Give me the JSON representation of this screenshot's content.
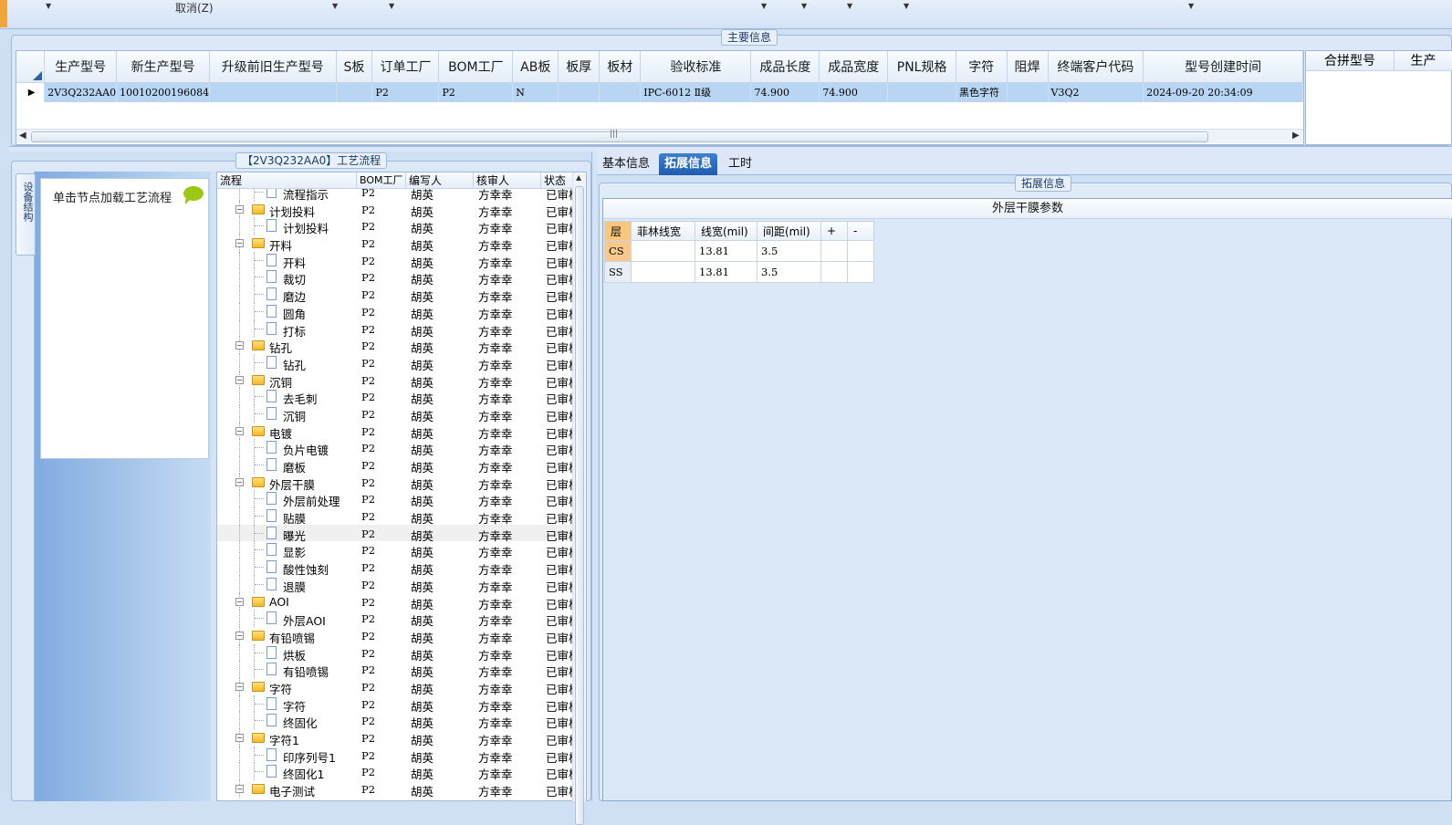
{
  "toolbar": {
    "cancel_label": "取消(Z)"
  },
  "main_info": {
    "caption": "主要信息",
    "columns": [
      "生产型号",
      "新生产型号",
      "升级前旧生产型号",
      "S板",
      "订单工厂",
      "BOM工厂",
      "AB板",
      "板厚",
      "板材",
      "验收标准",
      "成品长度",
      "成品宽度",
      "PNL规格",
      "字符",
      "阻焊",
      "终端客户代码",
      "型号创建时间"
    ],
    "row": [
      "2V3Q232AA0",
      "10010200196084",
      "",
      "",
      "P2",
      "P2",
      "N",
      "",
      "",
      "IPC-6012 Ⅱ级",
      "74.900",
      "74.900",
      "",
      "黑色字符",
      "",
      "V3Q2",
      "2024-09-20 20:34:09"
    ],
    "merge_columns": [
      "合拼型号",
      "生产"
    ]
  },
  "process": {
    "caption": "【2V3Q232AA0】工艺流程",
    "side_tab": "设备结构",
    "hint": "单击节点加载工艺流程",
    "columns": [
      "流程",
      "BOM工厂",
      "编写人",
      "核审人",
      "状态"
    ],
    "rows": [
      {
        "name": "流程指示",
        "type": "doc",
        "bom": "P2",
        "writer": "胡英",
        "reviewer": "方幸幸",
        "status": "已审核"
      },
      {
        "name": "计划投料",
        "type": "folder",
        "bom": "P2",
        "writer": "胡英",
        "reviewer": "方幸幸",
        "status": "已审核"
      },
      {
        "name": "计划投料",
        "type": "doc",
        "bom": "P2",
        "writer": "胡英",
        "reviewer": "方幸幸",
        "status": "已审核"
      },
      {
        "name": "开料",
        "type": "folder",
        "bom": "P2",
        "writer": "胡英",
        "reviewer": "方幸幸",
        "status": "已审核"
      },
      {
        "name": "开料",
        "type": "doc",
        "bom": "P2",
        "writer": "胡英",
        "reviewer": "方幸幸",
        "status": "已审核"
      },
      {
        "name": "裁切",
        "type": "doc",
        "bom": "P2",
        "writer": "胡英",
        "reviewer": "方幸幸",
        "status": "已审核"
      },
      {
        "name": "磨边",
        "type": "doc",
        "bom": "P2",
        "writer": "胡英",
        "reviewer": "方幸幸",
        "status": "已审核"
      },
      {
        "name": "圆角",
        "type": "doc",
        "bom": "P2",
        "writer": "胡英",
        "reviewer": "方幸幸",
        "status": "已审核"
      },
      {
        "name": "打标",
        "type": "doc",
        "bom": "P2",
        "writer": "胡英",
        "reviewer": "方幸幸",
        "status": "已审核"
      },
      {
        "name": "钻孔",
        "type": "folder",
        "bom": "P2",
        "writer": "胡英",
        "reviewer": "方幸幸",
        "status": "已审核"
      },
      {
        "name": "钻孔",
        "type": "doc",
        "bom": "P2",
        "writer": "胡英",
        "reviewer": "方幸幸",
        "status": "已审核"
      },
      {
        "name": "沉铜",
        "type": "folder",
        "bom": "P2",
        "writer": "胡英",
        "reviewer": "方幸幸",
        "status": "已审核"
      },
      {
        "name": "去毛刺",
        "type": "doc",
        "bom": "P2",
        "writer": "胡英",
        "reviewer": "方幸幸",
        "status": "已审核"
      },
      {
        "name": "沉铜",
        "type": "doc",
        "bom": "P2",
        "writer": "胡英",
        "reviewer": "方幸幸",
        "status": "已审核"
      },
      {
        "name": "电镀",
        "type": "folder",
        "bom": "P2",
        "writer": "胡英",
        "reviewer": "方幸幸",
        "status": "已审核"
      },
      {
        "name": "负片电镀",
        "type": "doc",
        "bom": "P2",
        "writer": "胡英",
        "reviewer": "方幸幸",
        "status": "已审核"
      },
      {
        "name": "磨板",
        "type": "doc",
        "bom": "P2",
        "writer": "胡英",
        "reviewer": "方幸幸",
        "status": "已审核"
      },
      {
        "name": "外层干膜",
        "type": "folder",
        "bom": "P2",
        "writer": "胡英",
        "reviewer": "方幸幸",
        "status": "已审核"
      },
      {
        "name": "外层前处理",
        "type": "doc",
        "bom": "P2",
        "writer": "胡英",
        "reviewer": "方幸幸",
        "status": "已审核"
      },
      {
        "name": "贴膜",
        "type": "doc",
        "bom": "P2",
        "writer": "胡英",
        "reviewer": "方幸幸",
        "status": "已审核"
      },
      {
        "name": "曝光",
        "type": "doc",
        "bom": "P2",
        "writer": "胡英",
        "reviewer": "方幸幸",
        "status": "已审核",
        "selected": true
      },
      {
        "name": "显影",
        "type": "doc",
        "bom": "P2",
        "writer": "胡英",
        "reviewer": "方幸幸",
        "status": "已审核"
      },
      {
        "name": "酸性蚀刻",
        "type": "doc",
        "bom": "P2",
        "writer": "胡英",
        "reviewer": "方幸幸",
        "status": "已审核"
      },
      {
        "name": "退膜",
        "type": "doc",
        "bom": "P2",
        "writer": "胡英",
        "reviewer": "方幸幸",
        "status": "已审核"
      },
      {
        "name": "AOI",
        "type": "folder",
        "bom": "P2",
        "writer": "胡英",
        "reviewer": "方幸幸",
        "status": "已审核"
      },
      {
        "name": "外层AOI",
        "type": "doc",
        "bom": "P2",
        "writer": "胡英",
        "reviewer": "方幸幸",
        "status": "已审核"
      },
      {
        "name": "有铅喷锡",
        "type": "folder",
        "bom": "P2",
        "writer": "胡英",
        "reviewer": "方幸幸",
        "status": "已审核"
      },
      {
        "name": "烘板",
        "type": "doc",
        "bom": "P2",
        "writer": "胡英",
        "reviewer": "方幸幸",
        "status": "已审核"
      },
      {
        "name": "有铅喷锡",
        "type": "doc",
        "bom": "P2",
        "writer": "胡英",
        "reviewer": "方幸幸",
        "status": "已审核"
      },
      {
        "name": "字符",
        "type": "folder",
        "bom": "P2",
        "writer": "胡英",
        "reviewer": "方幸幸",
        "status": "已审核"
      },
      {
        "name": "字符",
        "type": "doc",
        "bom": "P2",
        "writer": "胡英",
        "reviewer": "方幸幸",
        "status": "已审核"
      },
      {
        "name": "终固化",
        "type": "doc",
        "bom": "P2",
        "writer": "胡英",
        "reviewer": "方幸幸",
        "status": "已审核"
      },
      {
        "name": "字符1",
        "type": "folder",
        "bom": "P2",
        "writer": "胡英",
        "reviewer": "方幸幸",
        "status": "已审核"
      },
      {
        "name": "印序列号1",
        "type": "doc",
        "bom": "P2",
        "writer": "胡英",
        "reviewer": "方幸幸",
        "status": "已审核"
      },
      {
        "name": "终固化1",
        "type": "doc",
        "bom": "P2",
        "writer": "胡英",
        "reviewer": "方幸幸",
        "status": "已审核"
      },
      {
        "name": "电子测试",
        "type": "folder",
        "bom": "P2",
        "writer": "胡英",
        "reviewer": "方幸幸",
        "status": "已审核"
      }
    ]
  },
  "tabs": [
    {
      "label": "基本信息",
      "active": false
    },
    {
      "label": "拓展信息",
      "active": true
    },
    {
      "label": "工时",
      "active": false
    }
  ],
  "ext_info": {
    "caption": "拓展信息",
    "panel_title": "外层干膜参数",
    "columns": [
      "层",
      "菲林线宽",
      "线宽(mil)",
      "间距(mil)",
      "+",
      "-"
    ],
    "rows": [
      [
        "CS",
        "",
        "13.81",
        "3.5",
        "",
        ""
      ],
      [
        "SS",
        "",
        "13.81",
        "3.5",
        "",
        ""
      ]
    ]
  }
}
